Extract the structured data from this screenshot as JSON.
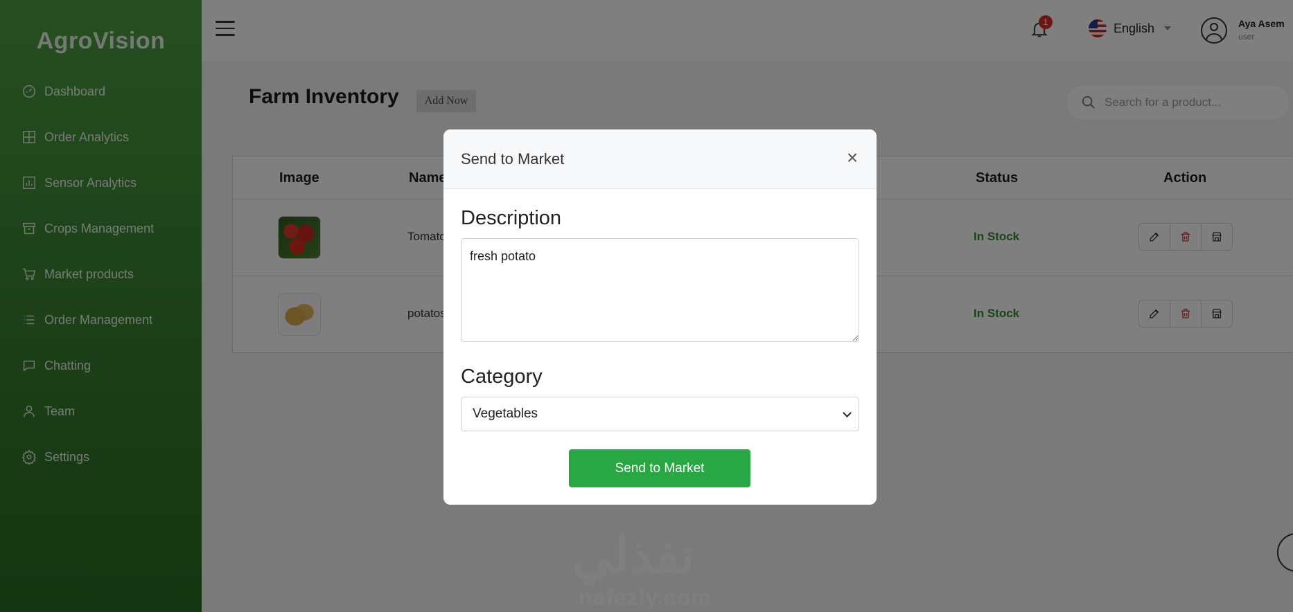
{
  "app": {
    "brand": "AgroVision"
  },
  "sidebar": {
    "items": [
      {
        "label": "Dashboard",
        "icon": "dashboard-icon"
      },
      {
        "label": "Order Analytics",
        "icon": "grid-icon"
      },
      {
        "label": "Sensor Analytics",
        "icon": "bar-chart-icon"
      },
      {
        "label": "Crops Management",
        "icon": "archive-icon"
      },
      {
        "label": "Market products",
        "icon": "cart-icon"
      },
      {
        "label": "Order Management",
        "icon": "list-icon"
      },
      {
        "label": "Chatting",
        "icon": "chat-icon"
      },
      {
        "label": "Team",
        "icon": "person-icon"
      },
      {
        "label": "Settings",
        "icon": "gear-icon"
      }
    ]
  },
  "header": {
    "notifications_count": "1",
    "language": "English",
    "user_name": "Aya Asem",
    "user_role": "user"
  },
  "main": {
    "title": "Farm Inventory",
    "add_now_label": "Add Now",
    "search_placeholder": "Search for a product...",
    "table": {
      "headers": {
        "image": "Image",
        "name": "Name",
        "status": "Status",
        "action": "Action"
      },
      "rows": [
        {
          "name": "Tomato",
          "status": "In Stock",
          "image": "tomato"
        },
        {
          "name": "potatos",
          "status": "In Stock",
          "image": "potato"
        }
      ]
    }
  },
  "modal": {
    "title": "Send to Market",
    "close_label": "×",
    "description_label": "Description",
    "description_value": "fresh potato",
    "category_label": "Category",
    "category_value": "Vegetables",
    "submit_label": "Send to Market"
  },
  "watermark": {
    "arabic": "نفذلي",
    "latin": "nafezly.com"
  },
  "colors": {
    "sidebar_green": "#3c8434",
    "status_green": "#2e8b2e",
    "button_green": "#27a844",
    "badge_red": "#d62e2e",
    "delete_red": "#d32f2f"
  }
}
